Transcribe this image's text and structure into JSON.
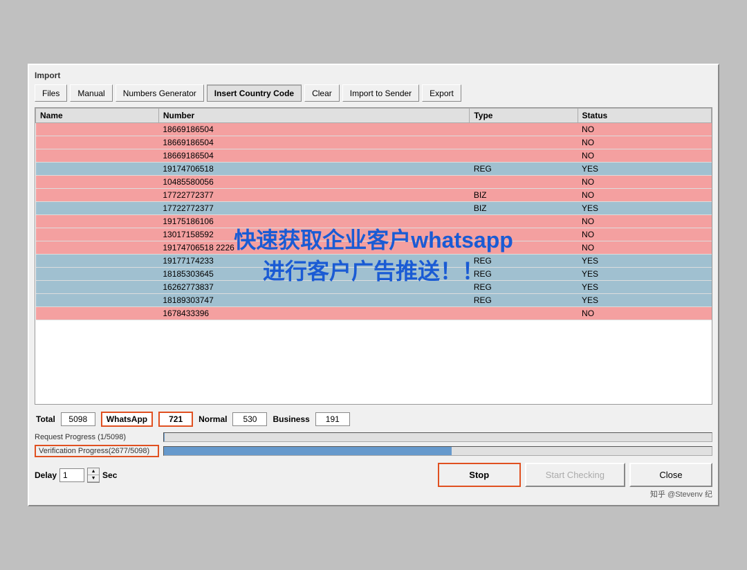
{
  "window": {
    "section_label": "Import"
  },
  "toolbar": {
    "buttons": [
      {
        "id": "files",
        "label": "Files",
        "active": false
      },
      {
        "id": "manual",
        "label": "Manual",
        "active": false
      },
      {
        "id": "numbers-generator",
        "label": "Numbers Generator",
        "active": false
      },
      {
        "id": "insert-country-code",
        "label": "Insert Country Code",
        "active": true
      },
      {
        "id": "clear",
        "label": "Clear",
        "active": false
      },
      {
        "id": "import-to-sender",
        "label": "Import to Sender",
        "active": false
      },
      {
        "id": "export",
        "label": "Export",
        "active": false
      }
    ]
  },
  "table": {
    "columns": [
      "Name",
      "Number",
      "Type",
      "Status"
    ],
    "rows": [
      {
        "name": "",
        "number": "18669186504",
        "type": "",
        "status": "NO",
        "color": "red"
      },
      {
        "name": "",
        "number": "18669186504",
        "type": "",
        "status": "NO",
        "color": "red"
      },
      {
        "name": "",
        "number": "18669186504",
        "type": "",
        "status": "NO",
        "color": "red"
      },
      {
        "name": "",
        "number": "19174706518",
        "type": "REG",
        "status": "YES",
        "color": "blue"
      },
      {
        "name": "",
        "number": "10485580056",
        "type": "",
        "status": "NO",
        "color": "red"
      },
      {
        "name": "",
        "number": "17722772377",
        "type": "BIZ",
        "status": "NO",
        "color": "red"
      },
      {
        "name": "",
        "number": "17722772377",
        "type": "BIZ",
        "status": "YES",
        "color": "blue"
      },
      {
        "name": "",
        "number": "19175186106",
        "type": "",
        "status": "NO",
        "color": "red"
      },
      {
        "name": "",
        "number": "13017158592",
        "type": "",
        "status": "NO",
        "color": "red"
      },
      {
        "name": "",
        "number": "19174706518 2226",
        "type": "",
        "status": "NO",
        "color": "red"
      },
      {
        "name": "",
        "number": "19177174233",
        "type": "REG",
        "status": "YES",
        "color": "blue"
      },
      {
        "name": "",
        "number": "18185303645",
        "type": "REG",
        "status": "YES",
        "color": "blue"
      },
      {
        "name": "",
        "number": "16262773837",
        "type": "REG",
        "status": "YES",
        "color": "blue"
      },
      {
        "name": "",
        "number": "18189303747",
        "type": "REG",
        "status": "YES",
        "color": "blue"
      },
      {
        "name": "",
        "number": "1678433396",
        "type": "",
        "status": "NO",
        "color": "red"
      }
    ]
  },
  "status_bar": {
    "total_label": "Total",
    "total_value": "5098",
    "whatsapp_label": "WhatsApp",
    "whatsapp_value": "721",
    "normal_label": "Normal",
    "normal_value": "530",
    "business_label": "Business",
    "business_value": "191"
  },
  "progress": {
    "request_label": "Request Progress (1/5098)",
    "request_percent": 0.02,
    "verification_label": "Verification Progress(2677/5098)",
    "verification_percent": 52.5
  },
  "delay": {
    "label": "Delay",
    "value": "1",
    "unit": "Sec"
  },
  "buttons": {
    "stop": "Stop",
    "start_checking": "Start Checking",
    "close": "Close"
  },
  "watermark": {
    "line1": "快速获取企业客户whatsapp",
    "line2": "进行客户广告推送！！"
  },
  "attribution": "知乎 @Stevenv 纪"
}
